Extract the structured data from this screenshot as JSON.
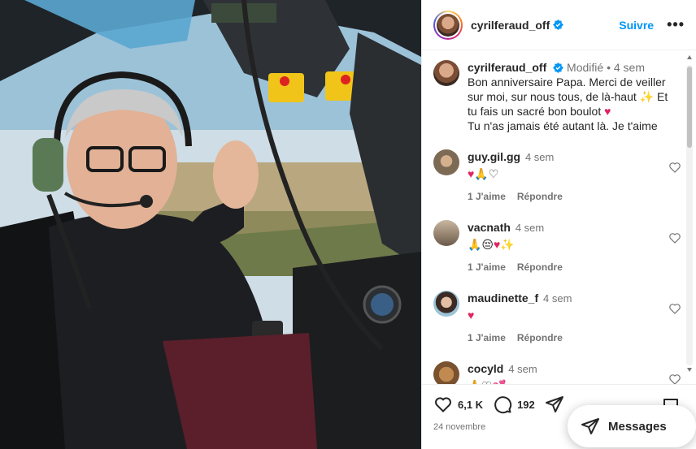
{
  "post": {
    "author": "cyrilferaud_off",
    "follow_label": "Suivre",
    "more_label": "•••",
    "caption": {
      "edited_label": "Modifié",
      "separator": "•",
      "time": "4 sem",
      "text_line1": "Bon anniversaire Papa. Merci de veiller sur moi, sur nous tous, de là-haut",
      "text_line2": "Et tu fais un sacré bon boulot",
      "text_line3": "Tu n'as jamais été autant là. Je t'aime"
    },
    "comments": [
      {
        "user": "guy.gil.gg",
        "time": "4 sem",
        "likes_label": "1 J'aime",
        "reply_label": "Répondre"
      },
      {
        "user": "vacnath",
        "time": "4 sem",
        "likes_label": "1 J'aime",
        "reply_label": "Répondre"
      },
      {
        "user": "maudinette_f",
        "time": "4 sem",
        "likes_label": "1 J'aime",
        "reply_label": "Répondre"
      },
      {
        "user": "cocyld",
        "time": "4 sem"
      }
    ],
    "likes_count": "6,1 K",
    "comments_count": "192",
    "date": "24 novembre",
    "messages_label": "Messages"
  },
  "colors": {
    "accent": "#0095f6",
    "text": "#262626",
    "muted": "#737373",
    "heart_red": "#ff3040"
  },
  "icons": [
    "verified-badge-icon",
    "heart-icon",
    "comment-icon",
    "share-icon",
    "bookmark-icon",
    "messages-icon",
    "more-icon"
  ]
}
